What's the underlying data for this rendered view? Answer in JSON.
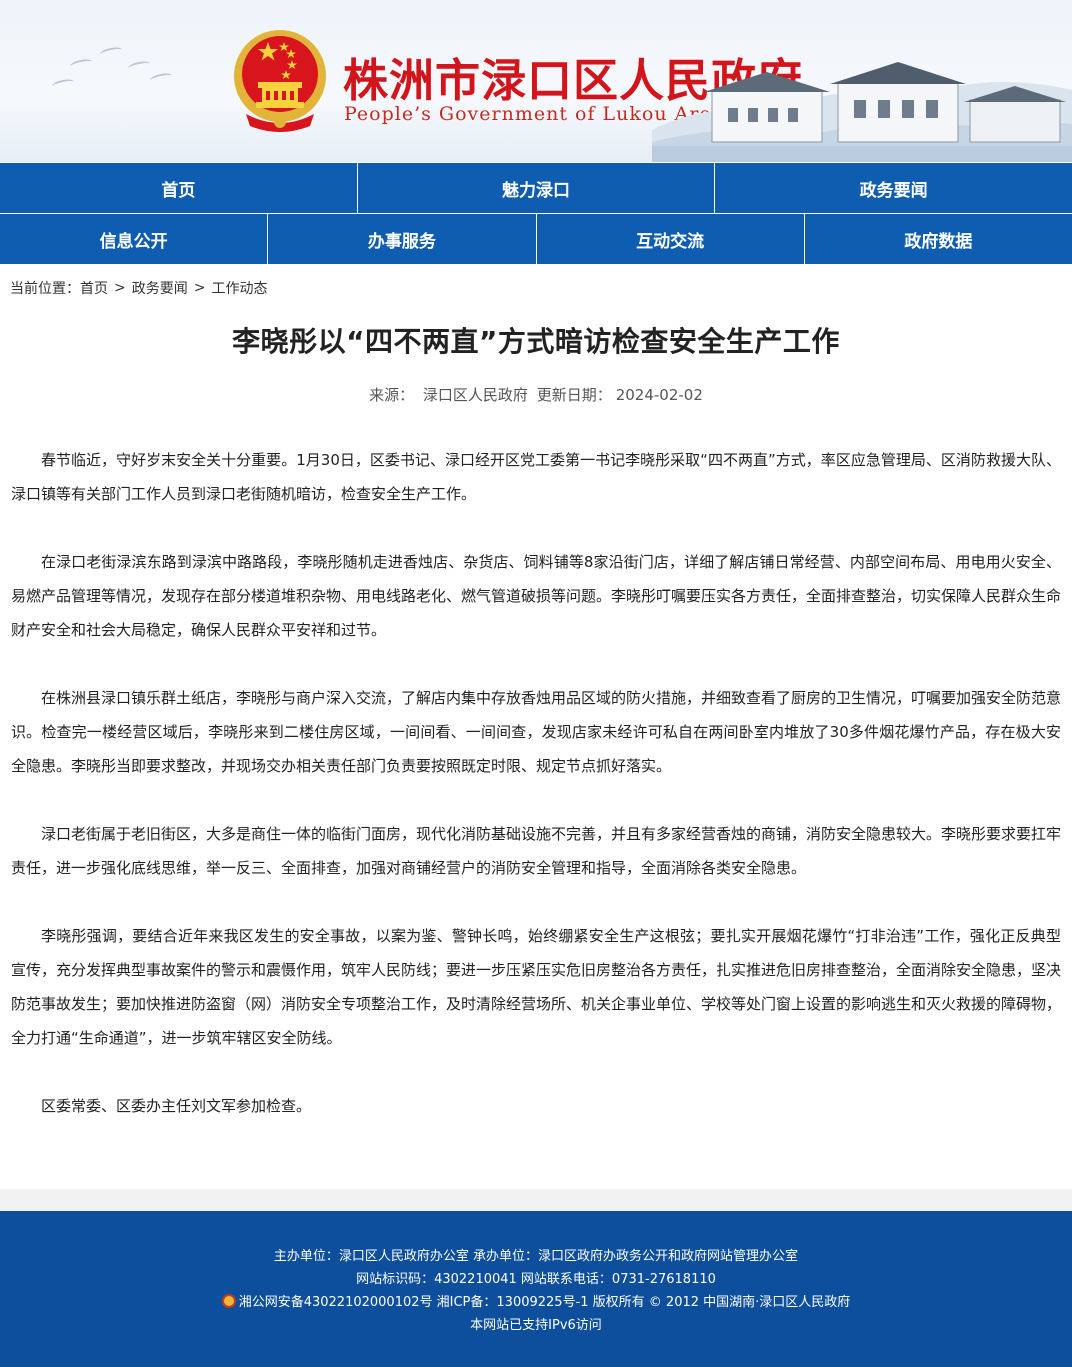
{
  "header": {
    "title": "株洲市渌口区人民政府",
    "subtitle": "People’s Government of Lukou Area in Zhuzhou",
    "emblem_icon": "national-emblem-icon"
  },
  "nav": {
    "row1": [
      {
        "label": "首页"
      },
      {
        "label": "魅力渌口"
      },
      {
        "label": "政务要闻"
      }
    ],
    "row2": [
      {
        "label": "信息公开"
      },
      {
        "label": "办事服务"
      },
      {
        "label": "互动交流"
      },
      {
        "label": "政府数据"
      }
    ]
  },
  "breadcrumb": {
    "prefix": "当前位置：",
    "items": [
      "首页",
      "政务要闻",
      "工作动态"
    ],
    "separator": ">"
  },
  "article": {
    "title": "李晓彤以“四不两直”方式暗访检查安全生产工作",
    "source_label": "来源：",
    "source": "渌口区人民政府",
    "date_label": "更新日期：",
    "date": "2024-02-02",
    "paragraphs": [
      "春节临近，守好岁末安全关十分重要。1月30日，区委书记、渌口经开区党工委第一书记李晓彤采取“四不两直”方式，率区应急管理局、区消防救援大队、渌口镇等有关部门工作人员到渌口老街随机暗访，检查安全生产工作。",
      "在渌口老街渌滨东路到渌滨中路路段，李晓彤随机走进香烛店、杂货店、饲料铺等8家沿街门店，详细了解店铺日常经营、内部空间布局、用电用火安全、易燃产品管理等情况，发现存在部分楼道堆积杂物、用电线路老化、燃气管道破损等问题。李晓彤叮嘱要压实各方责任，全面排查整治，切实保障人民群众生命财产安全和社会大局稳定，确保人民群众平安祥和过节。",
      "在株洲县渌口镇乐群土纸店，李晓彤与商户深入交流，了解店内集中存放香烛用品区域的防火措施，并细致查看了厨房的卫生情况，叮嘱要加强安全防范意识。检查完一楼经营区域后，李晓彤来到二楼住房区域，一间间看、一间间查，发现店家未经许可私自在两间卧室内堆放了30多件烟花爆竹产品，存在极大安全隐患。李晓彤当即要求整改，并现场交办相关责任部门负责要按照既定时限、规定节点抓好落实。",
      "渌口老街属于老旧街区，大多是商住一体的临街门面房，现代化消防基础设施不完善，并且有多家经营香烛的商铺，消防安全隐患较大。李晓彤要求要扛牢责任，进一步强化底线思维，举一反三、全面排查，加强对商铺经营户的消防安全管理和指导，全面消除各类安全隐患。",
      "李晓彤强调，要结合近年来我区发生的安全事故，以案为鉴、警钟长鸣，始终绷紧安全生产这根弦；要扎实开展烟花爆竹“打非治违”工作，强化正反典型宣传，充分发挥典型事故案件的警示和震慑作用，筑牢人民防线；要进一步压紧压实危旧房整治各方责任，扎实推进危旧房排查整治，全面消除安全隐患，坚决防范事故发生；要加快推进防盗窗（网）消防安全专项整治工作，及时清除经营场所、机关企事业单位、学校等处门窗上设置的影响逃生和灭火救援的障碍物，全力打通“生命通道”，进一步筑牢辖区安全防线。",
      "区委常委、区委办主任刘文军参加检查。"
    ]
  },
  "footer": {
    "line1": "主办单位：渌口区人民政府办公室 承办单位：渌口区政府办政务公开和政府网站管理办公室",
    "line2": "网站标识码：4302210041 网站联系电话：0731-27618110",
    "line3": "湘公网安备43022102000102号 湘ICP备：13009225号-1 版权所有 © 2012 中国湖南·渌口区人民政府",
    "line4": "本网站已支持IPv6访问",
    "police_icon": "police-badge-icon"
  },
  "colors": {
    "nav_bg": "#0f5db1",
    "title_red": "#d2141b",
    "footer_bg": "#0d4f9c"
  }
}
